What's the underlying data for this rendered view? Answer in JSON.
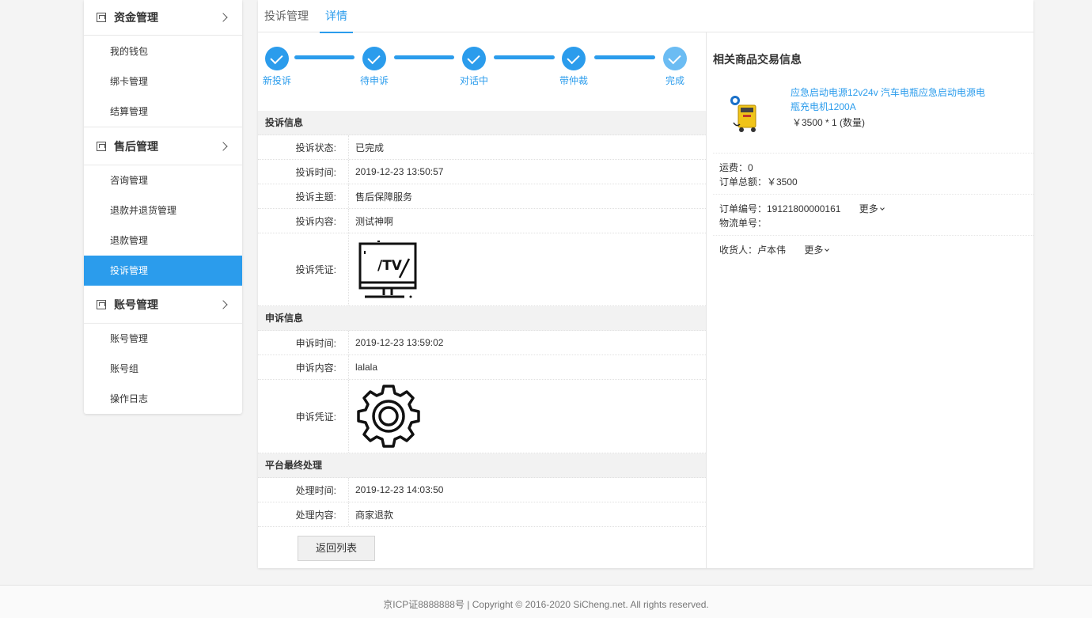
{
  "sidebar": {
    "groups": [
      {
        "title": "资金管理",
        "items": [
          "我的钱包",
          "绑卡管理",
          "结算管理"
        ]
      },
      {
        "title": "售后管理",
        "items": [
          "咨询管理",
          "退款并退货管理",
          "退款管理",
          "投诉管理"
        ]
      },
      {
        "title": "账号管理",
        "items": [
          "账号管理",
          "账号组",
          "操作日志"
        ]
      }
    ],
    "active_item": "投诉管理"
  },
  "tabs": [
    "投诉管理",
    "详情"
  ],
  "active_tab": "详情",
  "steps": [
    "新投诉",
    "待申诉",
    "对话中",
    "带仲裁",
    "完成"
  ],
  "complaint": {
    "section_title": "投诉信息",
    "status_label": "投诉状态:",
    "status": "已完成",
    "time_label": "投诉时间:",
    "time": "2019-12-23 13:50:57",
    "subject_label": "投诉主题:",
    "subject": "售后保障服务",
    "content_label": "投诉内容:",
    "content": "测试神啊",
    "evidence_label": "投诉凭证:",
    "evidence_icon": "tv-icon"
  },
  "appeal": {
    "section_title": "申诉信息",
    "time_label": "申诉时间:",
    "time": "2019-12-23 13:59:02",
    "content_label": "申诉内容:",
    "content": "lalala",
    "evidence_label": "申诉凭证:",
    "evidence_icon": "gear-icon"
  },
  "final": {
    "section_title": "平台最终处理",
    "time_label": "处理时间:",
    "time": "2019-12-23 14:03:50",
    "content_label": "处理内容:",
    "content": "商家退款"
  },
  "back_button": "返回列表",
  "trade": {
    "title": "相关商品交易信息",
    "product_name": "应急启动电源12v24v 汽车电瓶应急启动电源电瓶充电机1200A",
    "product_price": "￥3500 * 1 (数量)",
    "shipping": "运费：0",
    "total": "订单总额：￥3500",
    "order_no": "订单编号：19121800000161",
    "more": "更多",
    "logistics": "物流单号：",
    "receiver": "收货人：卢本伟"
  },
  "footer": "京ICP证8888888号 | Copyright © 2016-2020 SiCheng.net. All rights reserved.",
  "colors": {
    "accent": "#2b9cec",
    "background": "#f4f4f4"
  }
}
